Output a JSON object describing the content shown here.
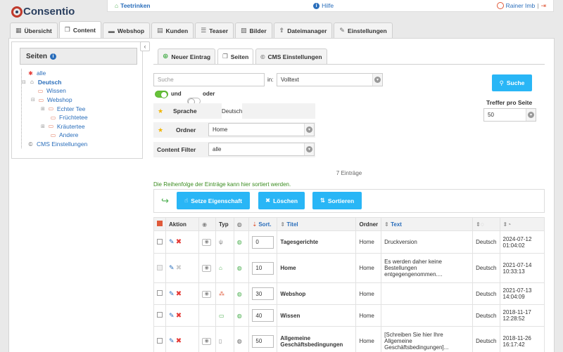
{
  "app": {
    "name": "Consentio"
  },
  "topbar": {
    "home_label": "Teetrinken",
    "help_label": "Hilfe",
    "user_name": "Rainer Imb",
    "separator": "|"
  },
  "main_tabs": [
    {
      "label": "Übersicht",
      "icon": "grid-icon"
    },
    {
      "label": "Content",
      "icon": "content-icon"
    },
    {
      "label": "Webshop",
      "icon": "truck-icon"
    },
    {
      "label": "Kunden",
      "icon": "customers-icon"
    },
    {
      "label": "Teaser",
      "icon": "teaser-icon"
    },
    {
      "label": "Bilder",
      "icon": "image-icon"
    },
    {
      "label": "Dateimanager",
      "icon": "upload-icon"
    },
    {
      "label": "Einstellungen",
      "icon": "wrench-icon"
    }
  ],
  "sidebar": {
    "title": "Seiten",
    "tree": [
      {
        "label": "alle",
        "icon": "asterisk-icon",
        "level": 0
      },
      {
        "label": "Deutsch",
        "icon": "home-icon",
        "level": 0
      },
      {
        "label": "Wissen",
        "icon": "folder-icon",
        "level": 1
      },
      {
        "label": "Webshop",
        "icon": "folder-icon",
        "level": 1
      },
      {
        "label": "Echter Tee",
        "icon": "folder-icon",
        "level": 2
      },
      {
        "label": "Früchtetee",
        "icon": "folder-icon",
        "level": 2
      },
      {
        "label": "Kräutertee",
        "icon": "folder-icon",
        "level": 2
      },
      {
        "label": "Andere",
        "icon": "folder-icon",
        "level": 2
      },
      {
        "label": "CMS Einstellungen",
        "icon": "copyright-icon",
        "level": 0
      }
    ]
  },
  "content_tabs": [
    {
      "label": "Neuer Eintrag",
      "icon": "plus-icon"
    },
    {
      "label": "Seiten",
      "icon": "pages-icon"
    },
    {
      "label": "CMS Einstellungen",
      "icon": "copyright-icon"
    }
  ],
  "filter": {
    "search_placeholder": "Suche",
    "in_label": "in:",
    "in_value": "Volltext",
    "and_label": "und",
    "or_label": "oder",
    "sprache_label": "Sprache",
    "sprache_value": "Deutsch",
    "ordner_label": "Ordner",
    "ordner_value": "Home",
    "content_filter_label": "Content Filter",
    "content_filter_value": "alle",
    "search_button": "Suche",
    "per_page_label": "Treffer pro Seite",
    "per_page_value": "50"
  },
  "list": {
    "count_text": "7 Einträge",
    "notice": "Die Reihenfolge der Einträge kann hier sortiert werden.",
    "actions": {
      "set_property": "Setze Eigenschaft",
      "delete": "Löschen",
      "sort": "Sortieren"
    },
    "columns": {
      "aktion": "Aktion",
      "typ": "Typ",
      "sort": "Sort.",
      "titel": "Titel",
      "ordner": "Ordner",
      "text": "Text"
    },
    "rows": [
      {
        "sort": "0",
        "title": "Tagesgerichte",
        "folder": "Home",
        "text": "Druckversion",
        "lang": "Deutsch",
        "date": "2024-07-12",
        "time": "01:04:02",
        "type_icon": "cutlery-icon"
      },
      {
        "sort": "10",
        "title": "Home",
        "folder": "Home",
        "text": "Es werden daher keine Bestellungen entgegengenommen....",
        "lang": "Deutsch",
        "date": "2021-07-14",
        "time": "10:33:13",
        "type_icon": "home-icon"
      },
      {
        "sort": "30",
        "title": "Webshop",
        "folder": "Home",
        "text": "",
        "lang": "Deutsch",
        "date": "2021-07-13",
        "time": "14:04:09",
        "type_icon": "sitemap-icon"
      },
      {
        "sort": "40",
        "title": "Wissen",
        "folder": "Home",
        "text": "",
        "lang": "Deutsch",
        "date": "2018-11-17",
        "time": "12:28:52",
        "type_icon": "folder-icon"
      },
      {
        "sort": "50",
        "title": "Allgemeine Geschäftsbedingungen",
        "folder": "Home",
        "text": "[Schreiben Sie hier Ihre Allgemeine Geschäftsbedingungen]...",
        "lang": "Deutsch",
        "date": "2018-11-26",
        "time": "16:17:42",
        "type_icon": "document-icon"
      }
    ]
  },
  "colors": {
    "accent": "#29b6f6",
    "link": "#2a6ebb",
    "danger": "#e53935",
    "success": "#4caf50"
  }
}
